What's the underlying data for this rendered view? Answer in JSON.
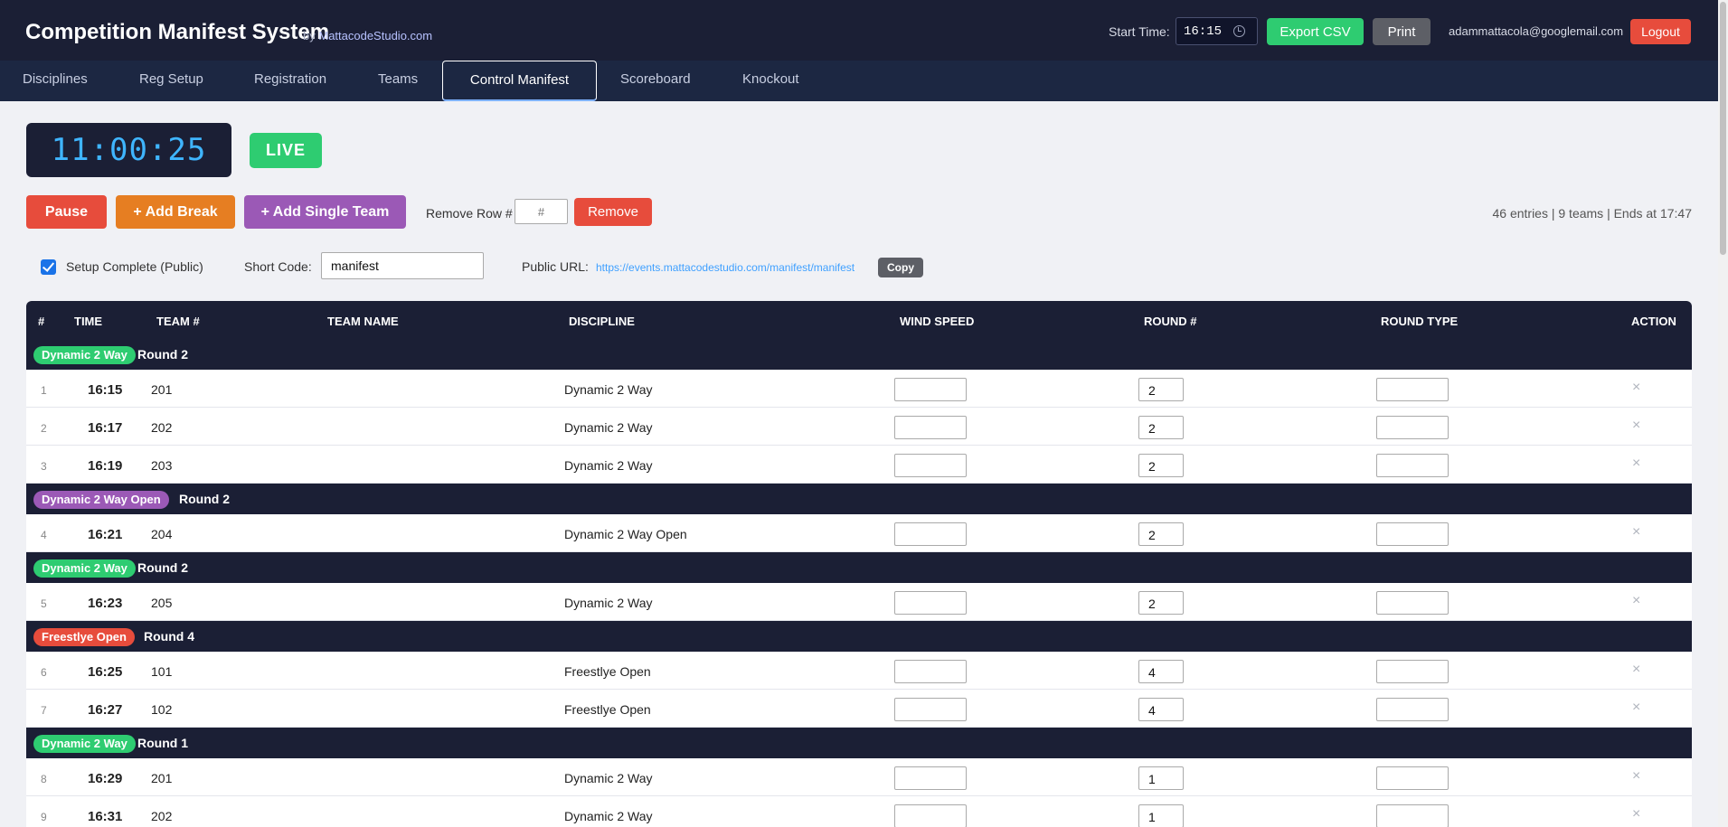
{
  "header": {
    "title": "Competition Manifest System",
    "by_prefix": "by",
    "brand": "MattacodeStudio.com",
    "start_time_label": "Start Time:",
    "start_time_value": "16:15",
    "export_label": "Export CSV",
    "print_label": "Print",
    "user_email": "adammattacola@googlemail.com",
    "logout_label": "Logout"
  },
  "nav": {
    "tabs": [
      "Disciplines",
      "Reg Setup",
      "Registration",
      "Teams",
      "Control Manifest",
      "Scoreboard",
      "Knockout"
    ],
    "active": "Control Manifest"
  },
  "controls": {
    "clock": "11:00:25",
    "live_label": "LIVE",
    "pause_label": "Pause",
    "add_break_label": "+ Add Break",
    "add_single_team_label": "+ Add Single Team",
    "remove_row_label": "Remove Row #",
    "remove_placeholder": "#",
    "remove_label": "Remove",
    "stats": "46 entries | 9 teams | Ends at 17:47",
    "setup_complete_label": "Setup Complete (Public)",
    "short_code_label": "Short Code:",
    "short_code_value": "manifest",
    "public_url_label": "Public URL:",
    "public_url": "https://events.mattacodestudio.com/manifest/manifest",
    "copy_label": "Copy"
  },
  "table": {
    "headers": {
      "num": "#",
      "time": "TIME",
      "team_num": "TEAM #",
      "team_name": "TEAM NAME",
      "discipline": "DISCIPLINE",
      "wind_speed": "WIND SPEED",
      "round_num": "ROUND #",
      "round_type": "ROUND TYPE",
      "action": "ACTION"
    },
    "colors": {
      "Dynamic 2 Way": "#2ecc71",
      "Dynamic 2 Way Open": "#9b59b6",
      "Freestlye Open": "#e74c3c"
    },
    "groups": [
      {
        "badge": "Dynamic 2 Way",
        "round": "Round 2",
        "rows": [
          {
            "num": "1",
            "time": "16:15",
            "team": "201",
            "discipline": "Dynamic 2 Way",
            "round": "2"
          },
          {
            "num": "2",
            "time": "16:17",
            "team": "202",
            "discipline": "Dynamic 2 Way",
            "round": "2"
          },
          {
            "num": "3",
            "time": "16:19",
            "team": "203",
            "discipline": "Dynamic 2 Way",
            "round": "2"
          }
        ]
      },
      {
        "badge": "Dynamic 2 Way Open",
        "round": "Round 2",
        "rows": [
          {
            "num": "4",
            "time": "16:21",
            "team": "204",
            "discipline": "Dynamic 2 Way Open",
            "round": "2"
          }
        ]
      },
      {
        "badge": "Dynamic 2 Way",
        "round": "Round 2",
        "rows": [
          {
            "num": "5",
            "time": "16:23",
            "team": "205",
            "discipline": "Dynamic 2 Way",
            "round": "2"
          }
        ]
      },
      {
        "badge": "Freestlye Open",
        "round": "Round 4",
        "rows": [
          {
            "num": "6",
            "time": "16:25",
            "team": "101",
            "discipline": "Freestlye Open",
            "round": "4"
          },
          {
            "num": "7",
            "time": "16:27",
            "team": "102",
            "discipline": "Freestlye Open",
            "round": "4"
          }
        ]
      },
      {
        "badge": "Dynamic 2 Way",
        "round": "Round 1",
        "rows": [
          {
            "num": "8",
            "time": "16:29",
            "team": "201",
            "discipline": "Dynamic 2 Way",
            "round": "1"
          },
          {
            "num": "9",
            "time": "16:31",
            "team": "202",
            "discipline": "Dynamic 2 Way",
            "round": "1"
          }
        ]
      }
    ],
    "delete_glyph": "×"
  }
}
